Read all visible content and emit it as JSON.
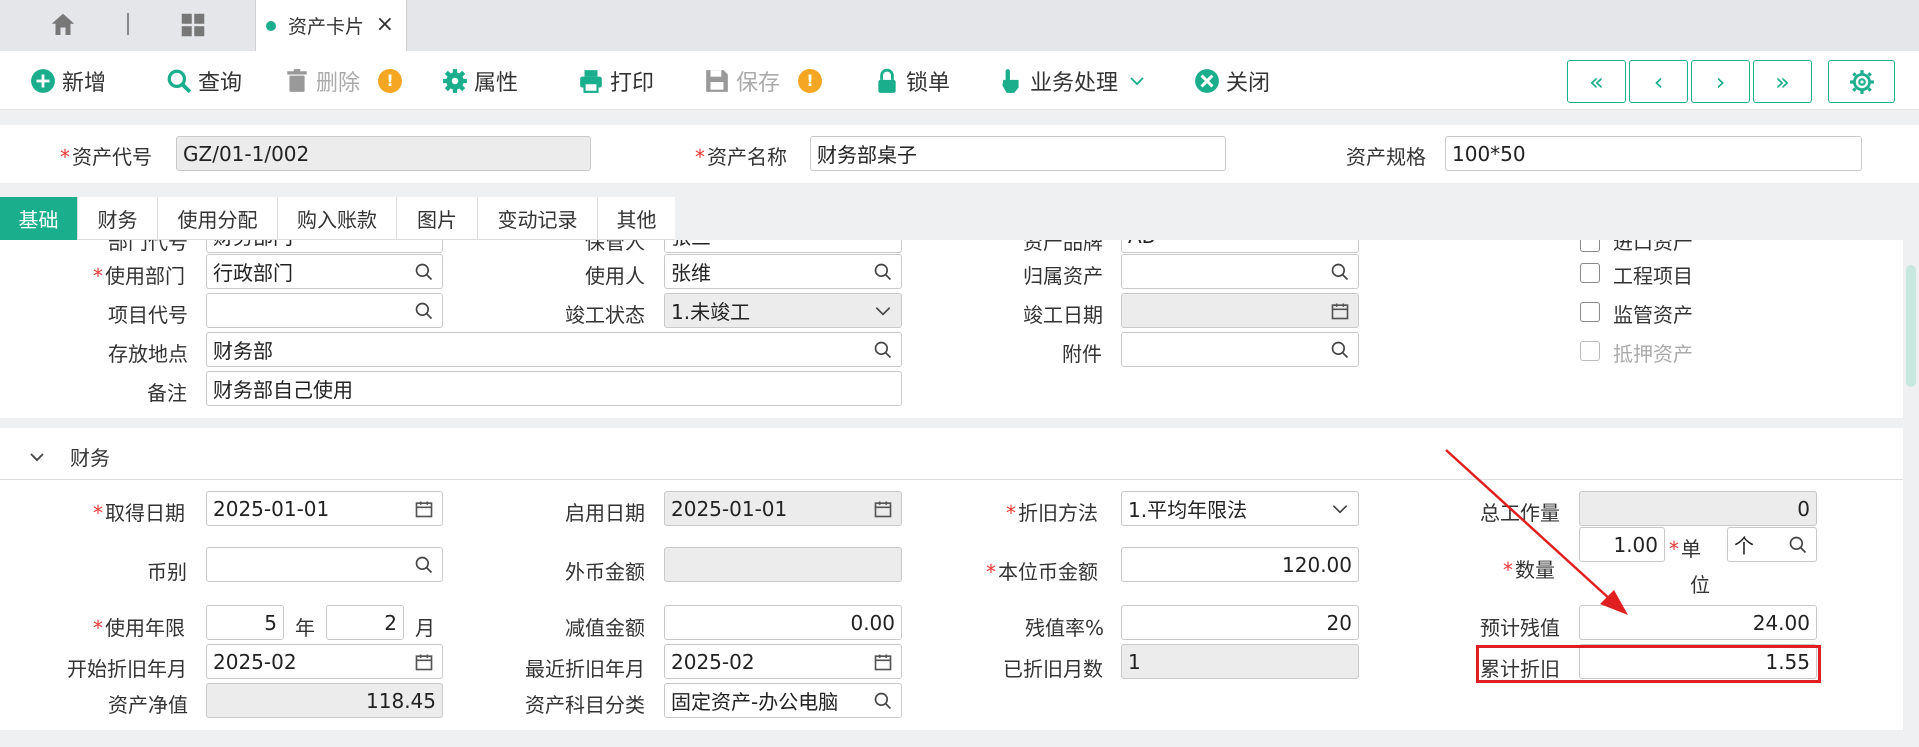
{
  "tabbar": {
    "active_tab": "资产卡片",
    "close_glyph": "×"
  },
  "toolbar": {
    "add": "新增",
    "query": "查询",
    "delete": "删除",
    "props": "属性",
    "print": "打印",
    "save": "保存",
    "lock": "锁单",
    "business": "业务处理",
    "close": "关闭",
    "warn_glyph": "!",
    "nav": [
      "«",
      "‹",
      "›",
      "»"
    ]
  },
  "header": {
    "asset_code_label": "资产代号",
    "asset_code": "GZ/01-1/002",
    "asset_name_label": "资产名称",
    "asset_name": "财务部桌子",
    "asset_spec_label": "资产规格",
    "asset_spec": "100*50"
  },
  "section_tabs": [
    "基础",
    "财务",
    "使用分配",
    "购入账款",
    "图片",
    "变动记录",
    "其他"
  ],
  "basic": {
    "dept_code_label": "部门代号",
    "dept_code": "财务部门",
    "keeper_label": "保管人",
    "keeper": "张三",
    "brand_label": "资产品牌",
    "brand": "AB",
    "imported_label": "进口资产",
    "use_dept_label": "使用部门",
    "use_dept": "行政部门",
    "user_label": "使用人",
    "user": "张维",
    "parent_label": "归属资产",
    "parent": "",
    "project_flag_label": "工程项目",
    "project_code_label": "项目代号",
    "project_code": "",
    "completion_status_label": "竣工状态",
    "completion_status": "1.未竣工",
    "completion_date_label": "竣工日期",
    "completion_date": "",
    "supervised_label": "监管资产",
    "location_label": "存放地点",
    "location": "财务部",
    "attachment_label": "附件",
    "attachment": "",
    "mortgage_label": "抵押资产",
    "remark_label": "备注",
    "remark": "财务部自己使用"
  },
  "finance": {
    "section_title": "财务",
    "acquire_date_label": "取得日期",
    "acquire_date": "2025-01-01",
    "start_date_label": "启用日期",
    "start_date": "2025-01-01",
    "dep_method_label": "折旧方法",
    "dep_method": "1.平均年限法",
    "total_work_label": "总工作量",
    "total_work": "0",
    "currency_label": "币别",
    "currency": "",
    "foreign_amount_label": "外币金额",
    "foreign_amount": "",
    "local_amount_label": "本位币金额",
    "local_amount": "120.00",
    "qty_label": "数量",
    "qty": "1.00",
    "unit_label_1": "单",
    "unit_label_2": "位",
    "unit": "个",
    "life_label": "使用年限",
    "life_years": "5",
    "year_unit": "年",
    "life_months": "2",
    "month_unit": "月",
    "impairment_label": "减值金额",
    "impairment": "0.00",
    "residual_rate_label": "残值率%",
    "residual_rate": "20",
    "est_residual_label": "预计残值",
    "est_residual": "24.00",
    "dep_start_label": "开始折旧年月",
    "dep_start": "2025-02",
    "last_dep_label": "最近折旧年月",
    "last_dep": "2025-02",
    "dep_months_label": "已折旧月数",
    "dep_months": "1",
    "accum_dep_label": "累计折旧",
    "accum_dep": "1.55",
    "net_value_label": "资产净值",
    "net_value": "118.45",
    "category_label": "资产科目分类",
    "category": "固定资产-办公电脑"
  },
  "colors": {
    "accent": "#1aae8c",
    "required": "#e53935",
    "highlight": "#e02020",
    "warn": "#f5a623"
  }
}
